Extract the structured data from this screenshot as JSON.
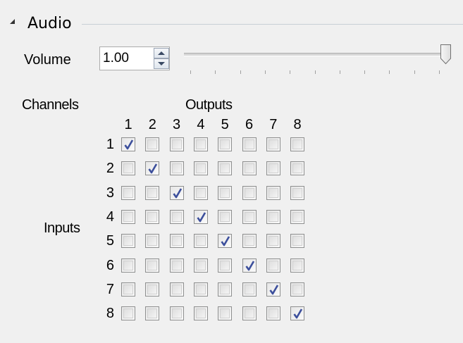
{
  "section": {
    "title": "Audio",
    "expanded": true
  },
  "volume": {
    "label": "Volume",
    "value": "1.00",
    "slider_fraction": 1.0,
    "tick_count": 11
  },
  "channels": {
    "label": "Channels",
    "outputs_label": "Outputs",
    "inputs_label": "Inputs",
    "outputs": [
      "1",
      "2",
      "3",
      "4",
      "5",
      "6",
      "7",
      "8"
    ],
    "inputs": [
      "1",
      "2",
      "3",
      "4",
      "5",
      "6",
      "7",
      "8"
    ],
    "matrix": [
      [
        true,
        false,
        false,
        false,
        false,
        false,
        false,
        false
      ],
      [
        false,
        true,
        false,
        false,
        false,
        false,
        false,
        false
      ],
      [
        false,
        false,
        true,
        false,
        false,
        false,
        false,
        false
      ],
      [
        false,
        false,
        false,
        true,
        false,
        false,
        false,
        false
      ],
      [
        false,
        false,
        false,
        false,
        true,
        false,
        false,
        false
      ],
      [
        false,
        false,
        false,
        false,
        false,
        true,
        false,
        false
      ],
      [
        false,
        false,
        false,
        false,
        false,
        false,
        true,
        false
      ],
      [
        false,
        false,
        false,
        false,
        false,
        false,
        false,
        true
      ]
    ]
  },
  "colors": {
    "check": "#3c4f9c",
    "border": "#8e8f8f",
    "background": "#f0f0f0"
  }
}
